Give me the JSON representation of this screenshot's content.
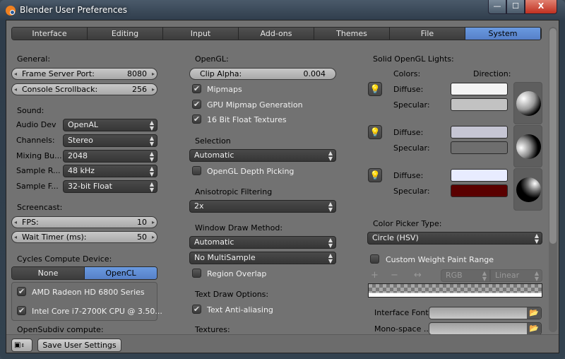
{
  "window": {
    "title": "Blender User Preferences",
    "min": "—",
    "max": "☐",
    "close": "X"
  },
  "tabs": [
    "Interface",
    "Editing",
    "Input",
    "Add-ons",
    "Themes",
    "File",
    "System"
  ],
  "active_tab": "System",
  "left": {
    "general": "General:",
    "frame_server_port": {
      "label": "Frame Server Port:",
      "value": "8080"
    },
    "console_scrollback": {
      "label": "Console Scrollback:",
      "value": "256"
    },
    "sound": "Sound:",
    "sound_rows": [
      {
        "label": "Audio Dev",
        "value": "OpenAL"
      },
      {
        "label": "Channels:",
        "value": "Stereo"
      },
      {
        "label": "Mixing Bu...",
        "value": "2048"
      },
      {
        "label": "Sample R...",
        "value": "48 kHz"
      },
      {
        "label": "Sample F...",
        "value": "32-bit Float"
      }
    ],
    "screencast": "Screencast:",
    "fps": {
      "label": "FPS:",
      "value": "10"
    },
    "wait_timer": {
      "label": "Wait Timer (ms):",
      "value": "50"
    },
    "cycles": "Cycles Compute Device:",
    "compute_options": [
      "None",
      "OpenCL"
    ],
    "compute_selected": "OpenCL",
    "devices": [
      {
        "label": "AMD Radeon HD 6800 Series",
        "checked": true
      },
      {
        "label": "Intel Core i7-2700K CPU @ 3.50...",
        "checked": true
      }
    ],
    "opensubdiv": "OpenSubdiv compute:"
  },
  "middle": {
    "opengl": "OpenGL:",
    "clip_alpha": {
      "label": "Clip Alpha:",
      "value": "0.004"
    },
    "mipmaps": {
      "label": "Mipmaps",
      "checked": true
    },
    "gpu_mipmap": {
      "label": "GPU Mipmap Generation",
      "checked": true
    },
    "float_tex": {
      "label": "16 Bit Float Textures",
      "checked": true
    },
    "selection": "Selection",
    "selection_value": "Automatic",
    "depth_picking": {
      "label": "OpenGL Depth Picking",
      "checked": false
    },
    "aniso": "Anisotropic Filtering",
    "aniso_value": "2x",
    "window_draw": "Window Draw Method:",
    "window_draw_value": "Automatic",
    "multisample_value": "No MultiSample",
    "region_overlap": {
      "label": "Region Overlap",
      "checked": false
    },
    "text_draw": "Text Draw Options:",
    "text_aa": {
      "label": "Text Anti-aliasing",
      "checked": true
    },
    "textures": "Textures:"
  },
  "right": {
    "solid_lights": "Solid OpenGL Lights:",
    "colors": "Colors:",
    "direction": "Direction:",
    "diffuse": "Diffuse:",
    "specular": "Specular:",
    "lights": [
      {
        "diffuse": "#f4f4f4",
        "specular": "#c2c2c2"
      },
      {
        "diffuse": "#c6c6d4",
        "specular": "#6e6e6e"
      },
      {
        "diffuse": "#e8ecff",
        "specular": "#5a0000"
      }
    ],
    "color_picker_type": "Color Picker Type:",
    "color_picker_value": "Circle (HSV)",
    "custom_weight": {
      "label": "Custom Weight Paint Range",
      "checked": false
    },
    "ramp_color_mode": "RGB",
    "ramp_interp": "Linear",
    "interface_font": "Interface Font:",
    "mono_font": "Mono-space ..."
  },
  "bottom": {
    "save": "Save User Settings"
  },
  "colors": {
    "accent": "#5a8ad4",
    "panel": "#727272"
  }
}
